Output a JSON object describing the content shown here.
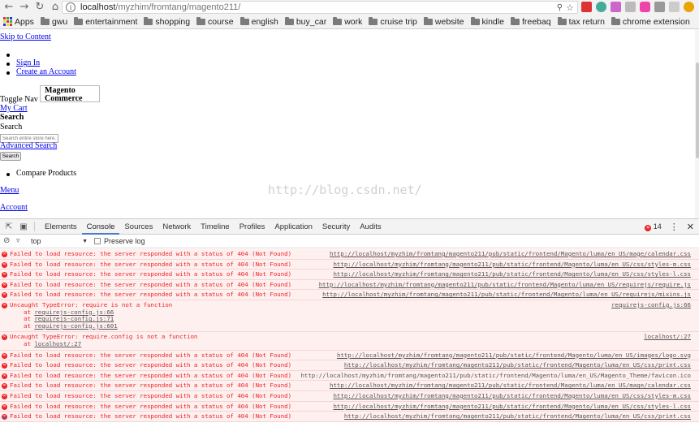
{
  "browser": {
    "url_host": "localhost",
    "url_path": "/myzhim/fromtang/magento211/",
    "bookmarks": [
      "Apps",
      "gwu",
      "entertainment",
      "shopping",
      "course",
      "english",
      "buy_car",
      "work",
      "cruise trip",
      "website",
      "kindle",
      "freebaq",
      "tax return",
      "chrome extension"
    ]
  },
  "page": {
    "skip_link": "Skip to Content",
    "sign_in": "Sign In",
    "create_account": "Create an Account",
    "toggle_nav": "Toggle Nav",
    "logo_alt": "Magento Commerce",
    "my_cart": "My Cart",
    "search_heading": "Search",
    "search_label": "Search",
    "search_placeholder": "Search entire store here...",
    "advanced_search": "Advanced Search",
    "search_button": "Search",
    "compare_products": "Compare Products",
    "menu": "Menu",
    "account": "Account",
    "watermark": "http://blog.csdn.net/"
  },
  "devtools": {
    "tabs": [
      "Elements",
      "Console",
      "Sources",
      "Network",
      "Timeline",
      "Profiles",
      "Application",
      "Security",
      "Audits"
    ],
    "active_tab": "Console",
    "error_count": "14",
    "context": "top",
    "preserve_log": "Preserve log",
    "messages": [
      {
        "text": "Failed to load resource: the server responded with a status of 404 (Not Found)",
        "source": "http://localhost/myzhim/fromtang/magento211/pub/static/frontend/Magento/luma/en_US/mage/calendar.css"
      },
      {
        "text": "Failed to load resource: the server responded with a status of 404 (Not Found)",
        "source": "http://localhost/myzhim/fromtang/magento211/pub/static/frontend/Magento/luma/en_US/css/styles-m.css"
      },
      {
        "text": "Failed to load resource: the server responded with a status of 404 (Not Found)",
        "source": "http://localhost/myzhim/fromtang/magento211/pub/static/frontend/Magento/luma/en_US/css/styles-l.css"
      },
      {
        "text": "Failed to load resource: the server responded with a status of 404 (Not Found)",
        "source": "http://localhost/myzhim/fromtang/magento211/pub/static/frontend/Magento/luma/en_US/requirejs/require.js"
      },
      {
        "text": "Failed to load resource: the server responded with a status of 404 (Not Found)",
        "source": "http://localhost/myzhim/fromtang/magento211/pub/static/frontend/Magento/luma/en_US/requirejs/mixins.js"
      }
    ],
    "error1": {
      "text": "Uncaught TypeError: require is not a function",
      "source": "requirejs-config.js:66",
      "stack": [
        "requirejs-config.js:66",
        "requirejs-config.js:71",
        "requirejs-config.js:601"
      ]
    },
    "error2": {
      "text": "Uncaught TypeError: require.config is not a function",
      "source": "localhost/:27",
      "stack": [
        "localhost/:27"
      ]
    },
    "messages2": [
      {
        "text": "Failed to load resource: the server responded with a status of 404 (Not Found)",
        "source": "http://localhost/myzhim/fromtang/magento211/pub/static/frontend/Magento/luma/en_US/images/logo.svg",
        "link": true
      },
      {
        "text": "Failed to load resource: the server responded with a status of 404 (Not Found)",
        "source": "http://localhost/myzhim/fromtang/magento211/pub/static/frontend/Magento/luma/en_US/css/print.css",
        "link": true
      },
      {
        "text": "Failed to load resource: the server responded with a status of 404 (Not Found)",
        "source": "http://localhost/myzhim/fromtang/magento211/pub/static/frontend/Magento/luma/en_US/Magento_Theme/favicon.ico",
        "link": false
      },
      {
        "text": "Failed to load resource: the server responded with a status of 404 (Not Found)",
        "source": "http://localhost/myzhim/fromtang/magento211/pub/static/frontend/Magento/luma/en_US/mage/calendar.css",
        "link": true
      },
      {
        "text": "Failed to load resource: the server responded with a status of 404 (Not Found)",
        "source": "http://localhost/myzhim/fromtang/magento211/pub/static/frontend/Magento/luma/en_US/css/styles-m.css",
        "link": true
      },
      {
        "text": "Failed to load resource: the server responded with a status of 404 (Not Found)",
        "source": "http://localhost/myzhim/fromtang/magento211/pub/static/frontend/Magento/luma/en_US/css/styles-l.css",
        "link": true
      },
      {
        "text": "Failed to load resource: the server responded with a status of 404 (Not Found)",
        "source": "http://localhost/myzhim/fromtang/magento211/pub/static/frontend/Magento/luma/en_US/css/print.css",
        "link": true
      }
    ],
    "prompt": ">",
    "colors": {
      "error": "#ee2222",
      "error_bg": "#fff0f0",
      "accent": "#4a7ec7"
    }
  }
}
